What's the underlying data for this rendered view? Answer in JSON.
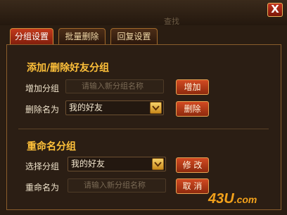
{
  "window": {
    "ghost_tab": "查找",
    "close_label": "X"
  },
  "tabs": [
    {
      "label": "分组设置",
      "active": true
    },
    {
      "label": "批量删除",
      "active": false
    },
    {
      "label": "回复设置",
      "active": false
    }
  ],
  "add_delete": {
    "title": "添加/删除好友分组",
    "add_label": "增加分组",
    "add_placeholder": "请输入新分组名称",
    "add_button": "增加",
    "delete_label": "删除名为",
    "delete_selected": "我的好友",
    "delete_button": "删除"
  },
  "rename": {
    "title": "重命名分组",
    "select_label": "选择分组",
    "select_selected": "我的好友",
    "modify_button": "修 改",
    "rename_label": "重命名为",
    "rename_placeholder": "请输入新分组名称",
    "cancel_button": "取 消"
  },
  "watermark": {
    "brand": "43U",
    "suffix": ".com"
  }
}
